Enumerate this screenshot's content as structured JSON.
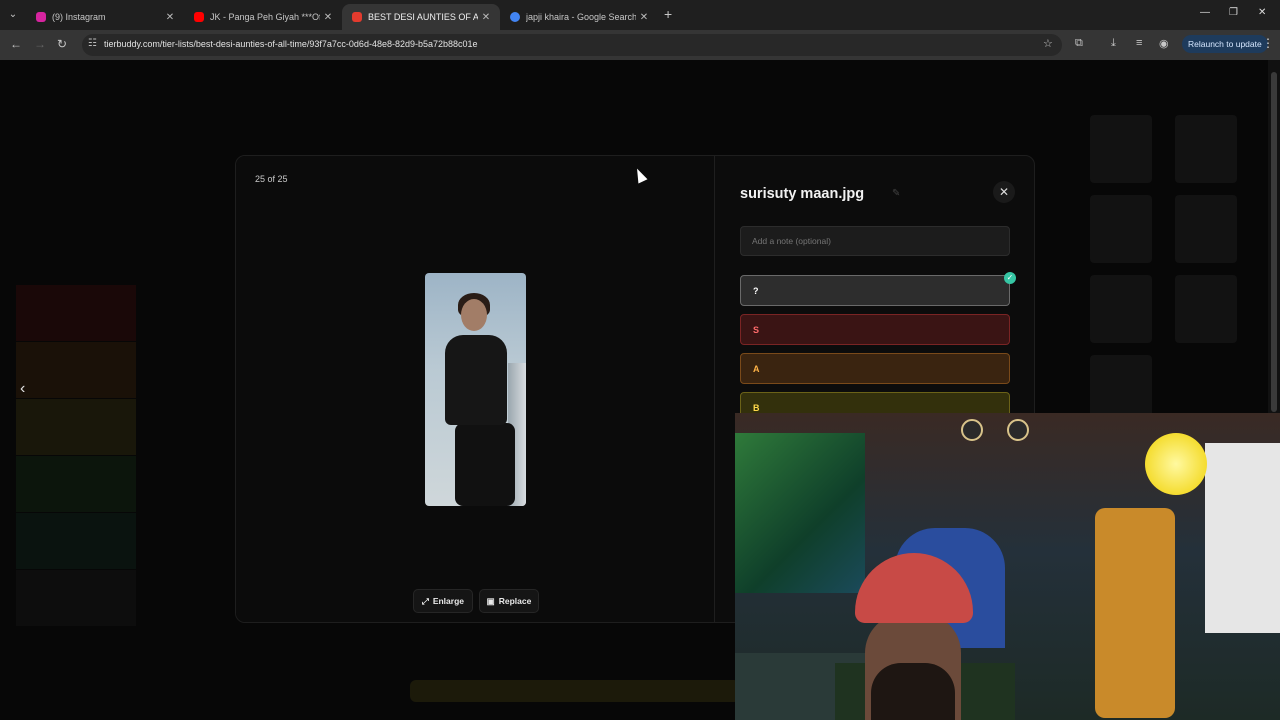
{
  "browser": {
    "tabs": [
      {
        "title": "(9) Instagram",
        "favicon_color": "#d6249f",
        "active": false
      },
      {
        "title": "JK - Panga Peh Giyah ***Official",
        "favicon_color": "#ff0000",
        "active": false
      },
      {
        "title": "BEST DESI AUNTIES OF ALL TIME",
        "favicon_color": "#e33b2e",
        "active": true
      },
      {
        "title": "japji khaira - Google Search",
        "favicon_color": "#4285f4",
        "active": false
      }
    ],
    "tab_close_glyph": "✕",
    "new_tab_glyph": "+",
    "url": "tierbuddy.com/tier-lists/best-desi-aunties-of-all-time/93f7a7cc-0d6d-48e8-82d9-b5a72b88c01e",
    "relaunch_label": "Relaunch to update"
  },
  "modal": {
    "counter": "25 of 25",
    "filename": "surisuty maan.jpg",
    "note_placeholder": "Add a note (optional)",
    "enlarge_label": "Enlarge",
    "replace_label": "Replace",
    "close_glyph": "✕",
    "tiers": [
      {
        "label": "?",
        "text_color": "#ffffff",
        "bg": "#2d2d2d",
        "border": "#6a6a6a",
        "selected": true
      },
      {
        "label": "S",
        "text_color": "#ff6b6b",
        "bg": "#3a1414",
        "border": "#7a2424",
        "selected": false
      },
      {
        "label": "A",
        "text_color": "#ffb347",
        "bg": "#3a2410",
        "border": "#7a4a1a",
        "selected": false
      },
      {
        "label": "B",
        "text_color": "#ffd84a",
        "bg": "#33300c",
        "border": "#6b6218",
        "selected": false
      }
    ]
  }
}
